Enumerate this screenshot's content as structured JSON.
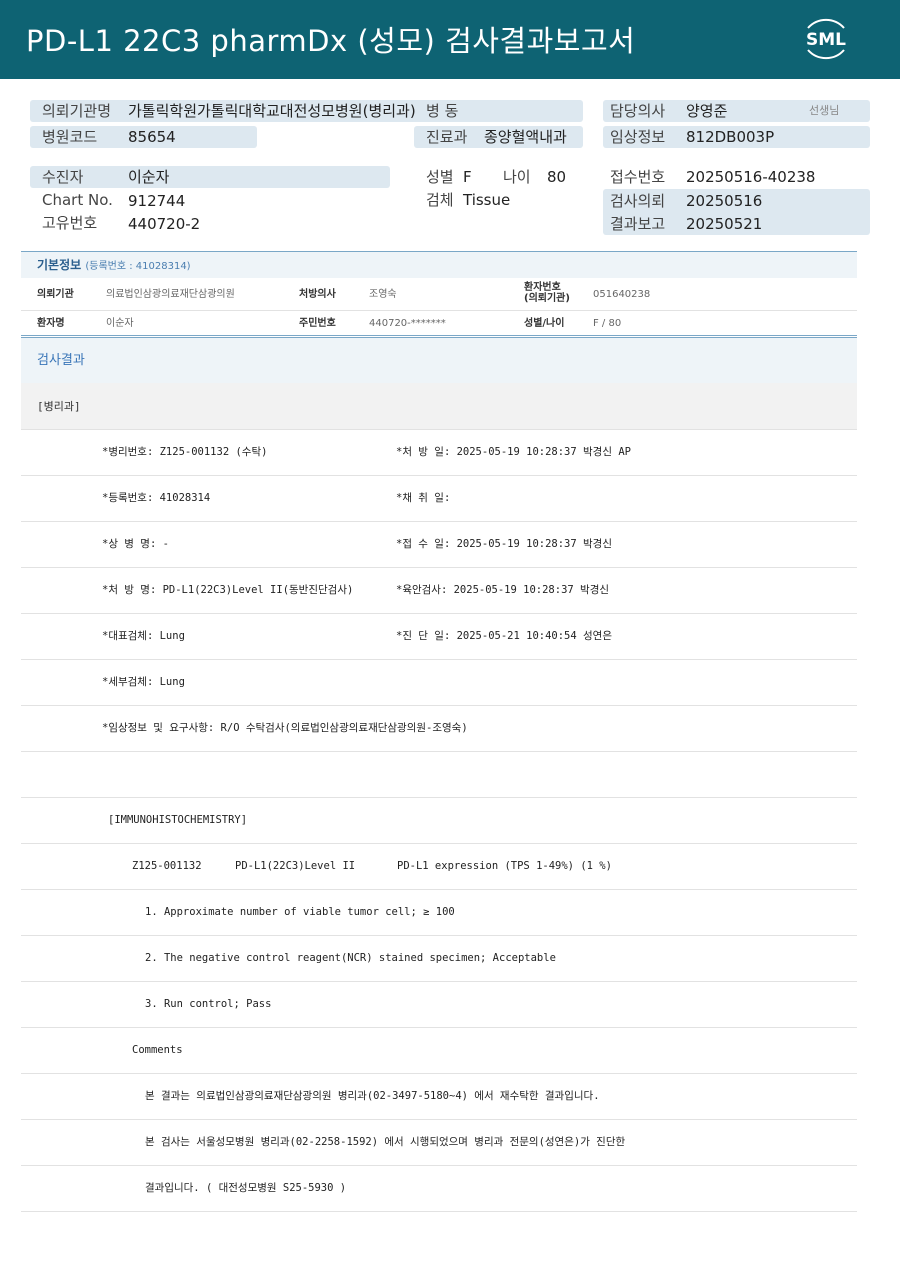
{
  "header": {
    "title": "PD-L1 22C3 pharmDx (성모) 검사결과보고서",
    "logo_text": "SML",
    "bg_color": "#0e6373"
  },
  "patient_info": {
    "institution_label": "의뢰기관명",
    "institution_value": "가톨릭학원가톨릭대학교대전성모병원(병리과)",
    "ward_label": "병 동",
    "doctor_label": "담당의사",
    "doctor_value": "양영준",
    "doctor_suffix": "선생님",
    "hospital_code_label": "병원코드",
    "hospital_code_value": "85654",
    "dept_label": "진료과",
    "dept_value": "종양혈액내과",
    "clinical_label": "임상정보",
    "clinical_value": "812DB003P",
    "patient_label": "수진자",
    "patient_value": "이순자",
    "sex_label": "성별",
    "sex_value": "F",
    "age_label": "나이",
    "age_value": "80",
    "receipt_label": "접수번호",
    "receipt_value": "20250516-40238",
    "chart_label": "Chart No.",
    "chart_value": "912744",
    "specimen_label": "검체",
    "specimen_value": "Tissue",
    "request_label": "검사의뢰",
    "request_value": "20250516",
    "unique_label": "고유번호",
    "unique_value": "440720-2",
    "report_label": "결과보고",
    "report_value": "20250521"
  },
  "basic_info": {
    "title": "기본정보",
    "reg_no": "(등록번호 : 41028314)",
    "row1": {
      "k1": "의뢰기관",
      "v1": "의료법인삼광의료재단삼광의원",
      "k2": "처방의사",
      "v2": "조영숙",
      "k3a": "환자번호",
      "k3b": "(의뢰기관)",
      "v3": "051640238"
    },
    "row2": {
      "k1": "환자명",
      "v1": "이순자",
      "k2": "주민번호",
      "v2": "440720-*******",
      "k3": "성별/나이",
      "v3": "F / 80"
    }
  },
  "results": {
    "title": "검사결과",
    "section": "[병리과]",
    "lines": [
      {
        "left": "*병리번호: Z125-001132 (수탁)",
        "right": "*처 방 일: 2025-05-19 10:28:37  박경신 AP"
      },
      {
        "left": "*등록번호: 41028314",
        "right": "*채 취 일:"
      },
      {
        "left": "*상 병 명: -",
        "right": "*접 수 일: 2025-05-19 10:28:37  박경신"
      },
      {
        "left": "*처 방 명: PD-L1(22C3)Level II(동반진단검사)",
        "right": "*육안검사: 2025-05-19 10:28:37  박경신"
      },
      {
        "left": "*대표검체: Lung",
        "right": "*진 단 일: 2025-05-21 10:40:54  성연은"
      },
      {
        "left": "*세부검체: Lung",
        "right": ""
      },
      {
        "left": "*임상정보 및 요구사항: R/O 수탁검사(의료법인삼광의료재단삼광의원-조영숙)",
        "right": ""
      },
      {
        "left": "",
        "right": ""
      }
    ],
    "ihc_title": "[IMMUNOHISTOCHEMISTRY]",
    "ihc_line": {
      "a": "Z125-001132",
      "b": "PD-L1(22C3)Level II",
      "c": "PD-L1 expression (TPS 1-49%) (1 %)"
    },
    "items": [
      "1. Approximate number of viable tumor cell; ≥ 100",
      "2. The negative control reagent(NCR) stained specimen; Acceptable",
      "3. Run control; Pass"
    ],
    "comments_label": "Comments",
    "comments": [
      "본 결과는 의료법인삼광의료재단삼광의원 병리과(02-3497-5180~4) 에서 재수탁한 결과입니다.",
      "본 검사는 서울성모병원 병리과(02-2258-1592) 에서 시행되었으며 병리과 전문의(성연은)가 진단한",
      "결과입니다. ( 대전성모병원 S25-5930 )"
    ]
  }
}
